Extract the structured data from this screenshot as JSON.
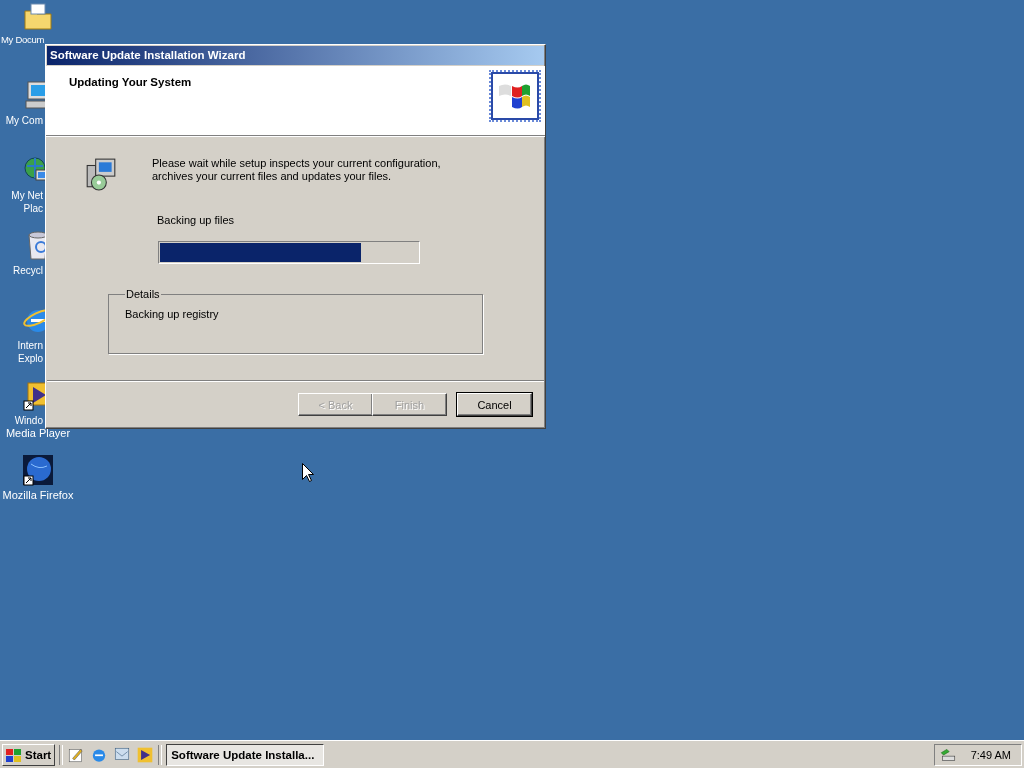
{
  "desktop_icons": [
    {
      "lines": [
        "My Docum"
      ]
    },
    {
      "lines": [
        "My Com"
      ]
    },
    {
      "lines": [
        "My Net",
        "Plac"
      ]
    },
    {
      "lines": [
        "Recycl"
      ]
    },
    {
      "lines": [
        "Intern",
        "Explo"
      ]
    },
    {
      "lines": [
        "Windo",
        "Media Player"
      ]
    },
    {
      "lines": [
        "Mozilla Firefox"
      ]
    }
  ],
  "dialog": {
    "title": "Software Update Installation Wizard",
    "heading": "Updating Your System",
    "message": "Please wait while setup inspects your current configuration, archives your current files and updates your files.",
    "status": "Backing up files",
    "progress": {
      "level": 0.78
    },
    "details": {
      "legend": "Details",
      "text": "Backing up registry"
    },
    "buttons": [
      {
        "label": "< Back",
        "disabled": true
      },
      {
        "label": "Finish",
        "disabled": true
      },
      {
        "label": "Cancel",
        "disabled": false
      }
    ]
  },
  "taskbar": {
    "start": "Start",
    "task": "Software Update Installa...",
    "clock": "7:49 AM"
  }
}
